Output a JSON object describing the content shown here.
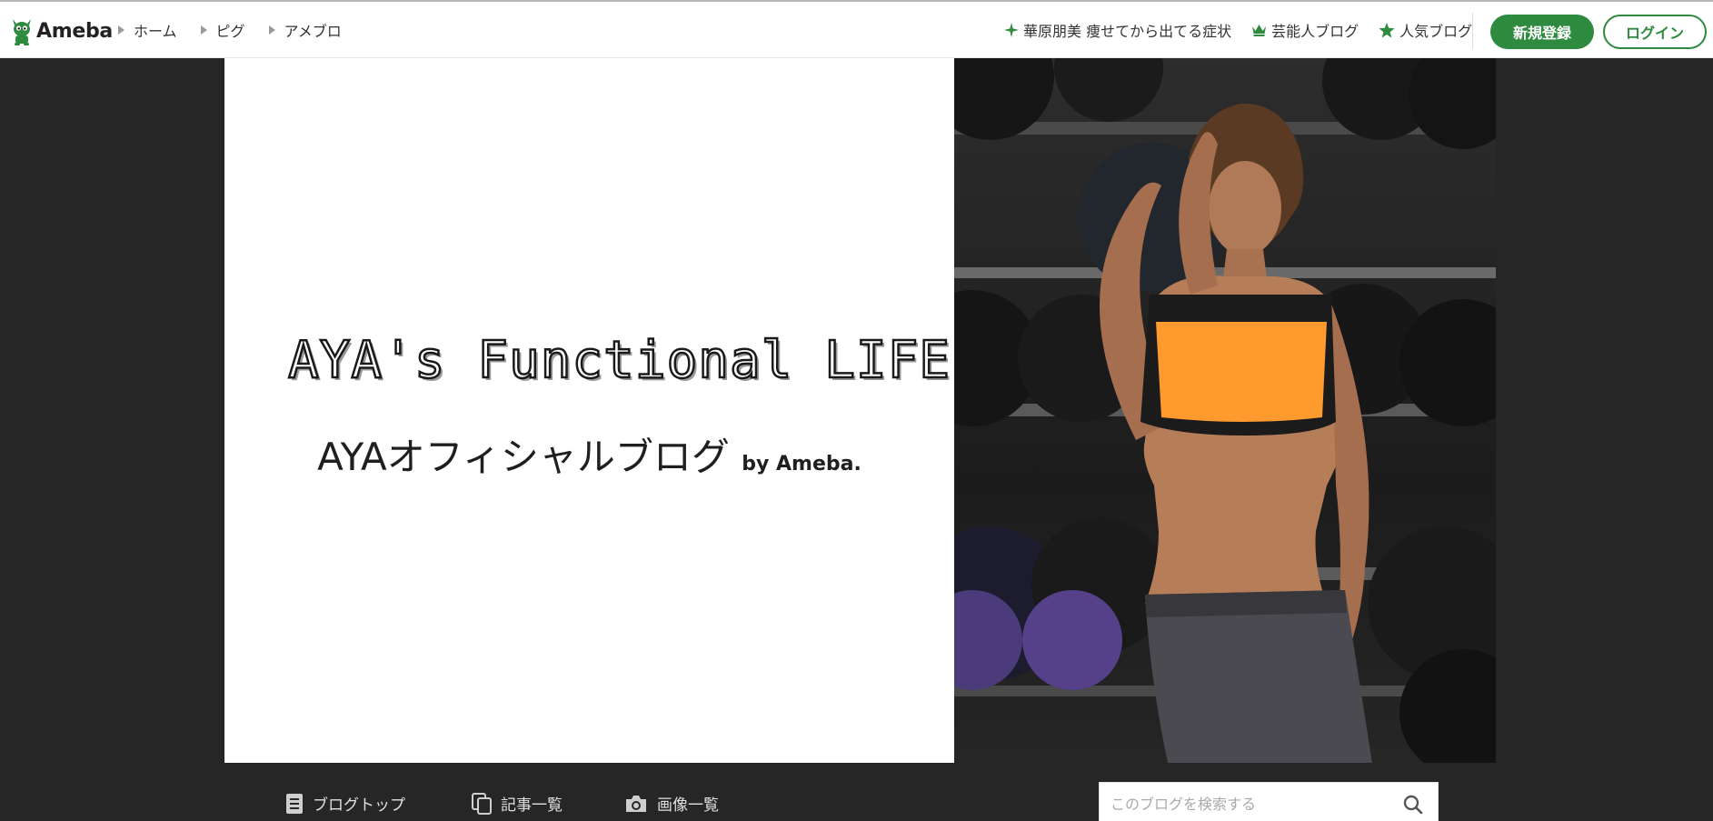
{
  "header": {
    "logo_text": "Ameba",
    "nav": [
      {
        "label": "ホーム"
      },
      {
        "label": "ピグ"
      },
      {
        "label": "アメブロ"
      }
    ],
    "links": [
      {
        "label": "華原朋美 痩せてから出てる症状",
        "icon": "sparkle-icon"
      },
      {
        "label": "芸能人ブログ",
        "icon": "crown-icon"
      },
      {
        "label": "人気ブログ",
        "icon": "star-icon"
      }
    ],
    "register_label": "新規登録",
    "login_label": "ログイン"
  },
  "banner": {
    "title": "AYA's Functional LIFE",
    "subtitle": "AYAオフィシャルブログ",
    "subtitle_by": "by Ameba."
  },
  "bottom_nav": {
    "items": [
      {
        "label": "ブログトップ",
        "icon": "document-icon"
      },
      {
        "label": "記事一覧",
        "icon": "copy-pages-icon"
      },
      {
        "label": "画像一覧",
        "icon": "camera-icon"
      }
    ],
    "search_placeholder": "このブログを検索する"
  },
  "colors": {
    "brand_green": "#2d8a3e",
    "page_background": "#262626",
    "accent_orange": "#ff9a2e"
  }
}
